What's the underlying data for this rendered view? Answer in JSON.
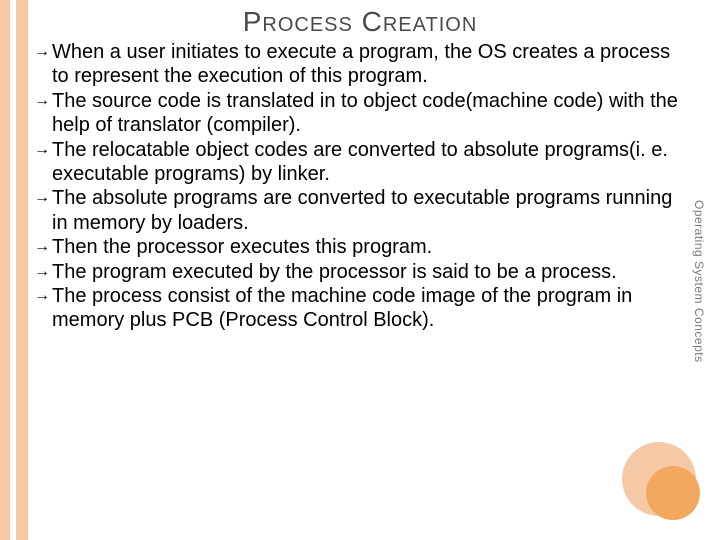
{
  "title": "Process Creation",
  "side_label": "Operating System Concepts",
  "bullets": [
    "When a user initiates to execute a program, the OS creates a process to represent the execution of this program.",
    "The source code is translated in to object code(machine code) with the help of translator (compiler).",
    "The relocatable object codes are converted to absolute programs(i. e. executable programs) by linker.",
    "The absolute programs are converted to executable programs running in memory by loaders.",
    "Then the processor executes this program.",
    "The program executed by the processor is said to be a process.",
    "The process consist of the machine code image of the program in memory plus PCB (Process Control Block)."
  ],
  "bullet_glyph": "→"
}
